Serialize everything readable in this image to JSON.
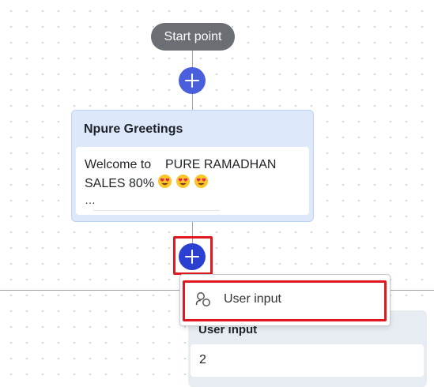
{
  "flow": {
    "start_label": "Start point",
    "greeting_node": {
      "title": "Npure Greetings",
      "message": "Welcome to    PURE RAMADHAN SALES 80%",
      "ellipsis": "…"
    },
    "user_input_node": {
      "title": "User input",
      "value": "2"
    }
  },
  "menu": {
    "items": [
      {
        "label": "User input",
        "icon": "users-icon"
      }
    ]
  },
  "colors": {
    "add_button": "#4a5fdb",
    "add_button_active": "#2b3fd0",
    "highlight": "#e0181f",
    "node_background": "#dde9fb",
    "start_pill": "#6b6e73"
  }
}
